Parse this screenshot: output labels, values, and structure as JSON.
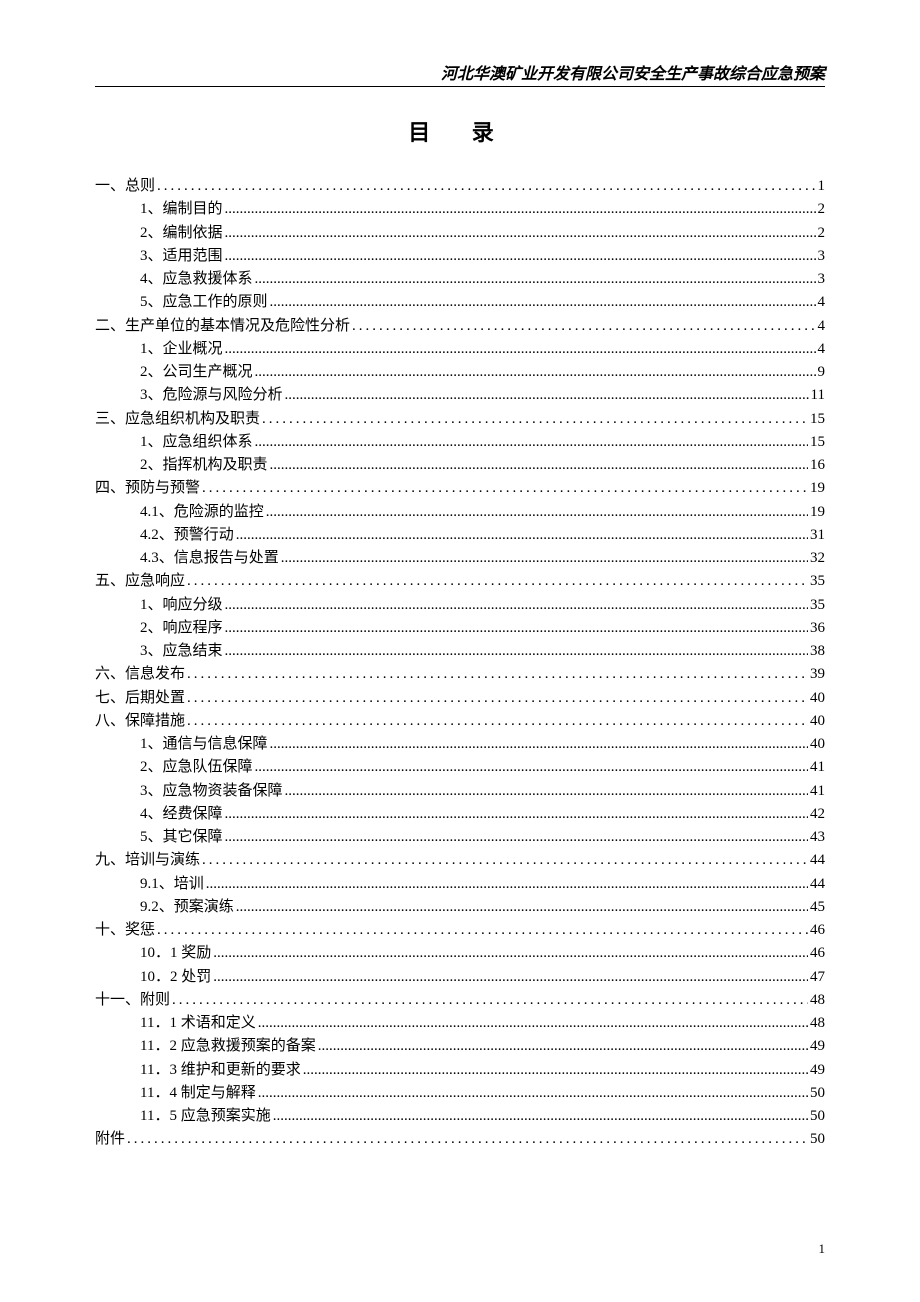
{
  "header": "河北华澳矿业开发有限公司安全生产事故综合应急预案",
  "toc_title": "目 录",
  "page_number": "1",
  "entries": [
    {
      "level": 1,
      "label": "一、总则",
      "page": "1"
    },
    {
      "level": 2,
      "label": "1、编制目的",
      "page": "2"
    },
    {
      "level": 2,
      "label": "2、编制依据",
      "page": "2"
    },
    {
      "level": 2,
      "label": "3、适用范围",
      "page": "3"
    },
    {
      "level": 2,
      "label": "4、应急救援体系",
      "page": "3"
    },
    {
      "level": 2,
      "label": "5、应急工作的原则",
      "page": "4"
    },
    {
      "level": 1,
      "label": "二、生产单位的基本情况及危险性分析",
      "page": "4"
    },
    {
      "level": 2,
      "label": "1、企业概况",
      "page": "4"
    },
    {
      "level": 2,
      "label": "2、公司生产概况",
      "page": "9"
    },
    {
      "level": 2,
      "label": "3、危险源与风险分析",
      "page": "11"
    },
    {
      "level": 1,
      "label": "三、应急组织机构及职责",
      "page": "15"
    },
    {
      "level": 2,
      "label": "1、应急组织体系",
      "page": "15"
    },
    {
      "level": 2,
      "label": "2、指挥机构及职责",
      "page": "16"
    },
    {
      "level": 1,
      "label": "四、预防与预警",
      "page": "19"
    },
    {
      "level": 2,
      "label": "4.1、危险源的监控",
      "page": "19"
    },
    {
      "level": 2,
      "label": "4.2、预警行动",
      "page": "31"
    },
    {
      "level": 2,
      "label": "4.3、信息报告与处置",
      "page": "32"
    },
    {
      "level": 1,
      "label": "五、应急响应",
      "page": "35"
    },
    {
      "level": 2,
      "label": "1、响应分级",
      "page": "35"
    },
    {
      "level": 2,
      "label": "2、响应程序",
      "page": "36"
    },
    {
      "level": 2,
      "label": "3、应急结束",
      "page": "38"
    },
    {
      "level": 1,
      "label": "六、信息发布",
      "page": "39"
    },
    {
      "level": 1,
      "label": "七、后期处置",
      "page": "40"
    },
    {
      "level": 1,
      "label": "八、保障措施",
      "page": "40"
    },
    {
      "level": 2,
      "label": "1、通信与信息保障",
      "page": "40"
    },
    {
      "level": 2,
      "label": "2、应急队伍保障",
      "page": "41"
    },
    {
      "level": 2,
      "label": "3、应急物资装备保障",
      "page": "41"
    },
    {
      "level": 2,
      "label": "4、经费保障",
      "page": "42"
    },
    {
      "level": 2,
      "label": "5、其它保障",
      "page": "43"
    },
    {
      "level": 1,
      "label": "九、培训与演练",
      "page": "44"
    },
    {
      "level": 2,
      "label": "9.1、培训",
      "page": "44"
    },
    {
      "level": 2,
      "label": "9.2、预案演练",
      "page": "45"
    },
    {
      "level": 1,
      "label": "十、奖惩",
      "page": "46"
    },
    {
      "level": 2,
      "label": "10．1 奖励",
      "page": "46"
    },
    {
      "level": 2,
      "label": "10．2 处罚",
      "page": "47"
    },
    {
      "level": 1,
      "label": "十一、附则",
      "page": "48"
    },
    {
      "level": 2,
      "label": "11．1 术语和定义",
      "page": "48"
    },
    {
      "level": 2,
      "label": "11．2 应急救援预案的备案",
      "page": "49"
    },
    {
      "level": 2,
      "label": "11．3 维护和更新的要求",
      "page": "49"
    },
    {
      "level": 2,
      "label": "11．4 制定与解释",
      "page": "50"
    },
    {
      "level": 2,
      "label": "11．5 应急预案实施",
      "page": "50"
    },
    {
      "level": 1,
      "label": "附件",
      "page": "50"
    }
  ]
}
